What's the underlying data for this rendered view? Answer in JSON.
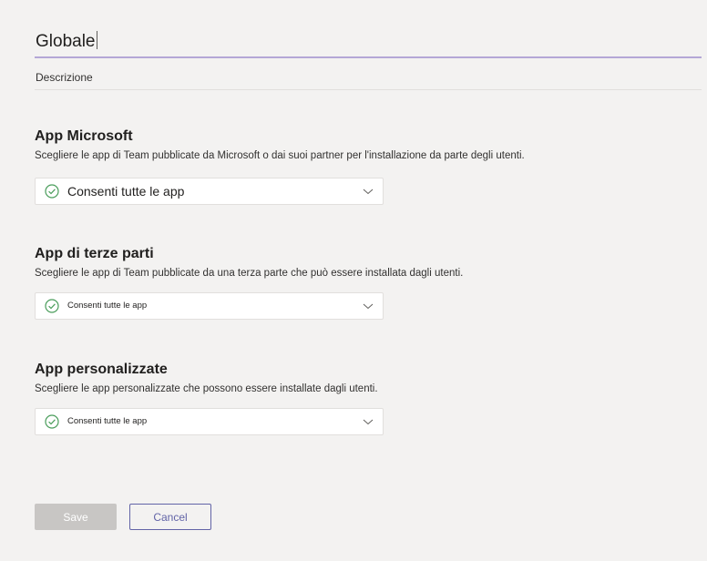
{
  "policy": {
    "name": "Globale",
    "description_placeholder": "Descrizione"
  },
  "sections": [
    {
      "title": "App Microsoft",
      "description": "Scegliere le app di Team pubblicate da Microsoft o dai suoi partner per l'installazione da parte degli utenti.",
      "selected": "Consenti tutte le app"
    },
    {
      "title": "App di terze parti",
      "description": "Scegliere le app di Team pubblicate da una terza parte che può essere installata dagli utenti.",
      "selected": "Consenti tutte le app"
    },
    {
      "title": "App personalizzate",
      "description": "Scegliere le app personalizzate che possono essere installate dagli utenti.",
      "selected": "Consenti tutte le app"
    }
  ],
  "actions": {
    "save_label": "Save",
    "cancel_label": "Cancel"
  },
  "colors": {
    "accent": "#6264a7",
    "check": "#4a9d5b",
    "disabled_button": "#c8c6c4"
  },
  "icons": {
    "option_status": "check-circle-icon",
    "dropdown": "chevron-down-icon"
  }
}
